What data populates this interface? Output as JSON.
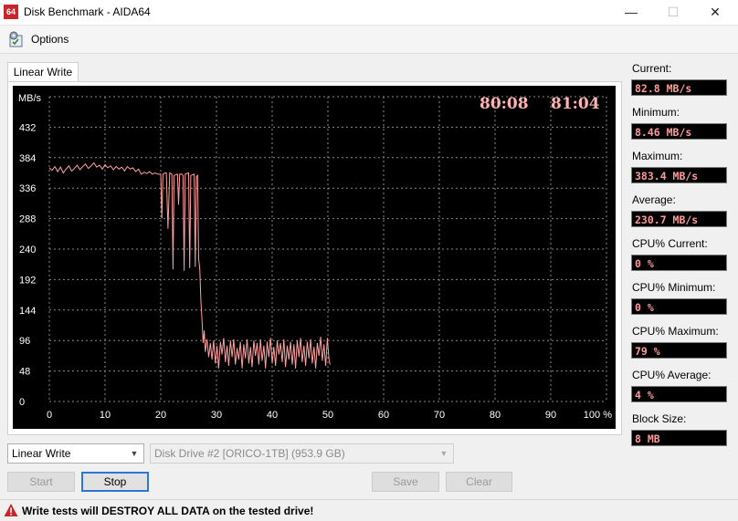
{
  "window": {
    "app_icon_text": "64",
    "title": "Disk Benchmark - AIDA64",
    "minimize": "—",
    "maximize": "☐",
    "close": "✕"
  },
  "menu": {
    "options_label": "Options",
    "options_icon": "options-icon"
  },
  "tab": {
    "label": "Linear Write"
  },
  "chart_data": {
    "type": "line",
    "ylabel": "MB/s",
    "y_ticks": [
      "432",
      "384",
      "336",
      "288",
      "240",
      "192",
      "144",
      "96",
      "48",
      "0"
    ],
    "x_ticks": [
      "0",
      "10",
      "20",
      "30",
      "40",
      "50",
      "60",
      "70",
      "80",
      "90",
      "100 %"
    ],
    "ylim": [
      0,
      480
    ],
    "xlim": [
      0,
      100
    ],
    "grid": true,
    "timers": [
      "80:08",
      "81:04"
    ],
    "colors": {
      "background": "#000000",
      "grid": "#8a8a8a",
      "line": "#ff9f9f",
      "axis_text": "#ffffff",
      "timer_text": "#ffb3b3"
    },
    "series": [
      {
        "values": [
          [
            0,
            368
          ],
          [
            0.5,
            364
          ],
          [
            1,
            370
          ],
          [
            1.5,
            362
          ],
          [
            2,
            369
          ],
          [
            2.5,
            360
          ],
          [
            3,
            366
          ],
          [
            3.5,
            371
          ],
          [
            4,
            363
          ],
          [
            4.5,
            367
          ],
          [
            5,
            372
          ],
          [
            5.5,
            365
          ],
          [
            6,
            370
          ],
          [
            6.5,
            374
          ],
          [
            7,
            367
          ],
          [
            7.5,
            371
          ],
          [
            8,
            376
          ],
          [
            8.5,
            369
          ],
          [
            9,
            372
          ],
          [
            9.5,
            366
          ],
          [
            10,
            373
          ],
          [
            10.5,
            368
          ],
          [
            11,
            371
          ],
          [
            11.5,
            365
          ],
          [
            12,
            370
          ],
          [
            12.5,
            366
          ],
          [
            13,
            369
          ],
          [
            13.5,
            363
          ],
          [
            14,
            370
          ],
          [
            14.5,
            366
          ],
          [
            15,
            368
          ],
          [
            15.5,
            362
          ],
          [
            16,
            366
          ],
          [
            16.5,
            358
          ],
          [
            17,
            361
          ],
          [
            17.5,
            359
          ],
          [
            18,
            362
          ],
          [
            18.5,
            358
          ],
          [
            19,
            360
          ],
          [
            19.5,
            358
          ],
          [
            20,
            358
          ],
          [
            20.2,
            288
          ],
          [
            20.4,
            358
          ],
          [
            20.8,
            360
          ],
          [
            21,
            360
          ],
          [
            21.3,
            272
          ],
          [
            21.6,
            360
          ],
          [
            22,
            358
          ],
          [
            22.2,
            208
          ],
          [
            22.4,
            356
          ],
          [
            23,
            358
          ],
          [
            23.2,
            310
          ],
          [
            23.4,
            358
          ],
          [
            23.8,
            358
          ],
          [
            24,
            356
          ],
          [
            24.2,
            206
          ],
          [
            24.4,
            358
          ],
          [
            25,
            360
          ],
          [
            25.2,
            210
          ],
          [
            25.4,
            356
          ],
          [
            26,
            358
          ],
          [
            26.2,
            212
          ],
          [
            26.4,
            354
          ],
          [
            26.6,
            356
          ],
          [
            26.8,
            224
          ],
          [
            27,
            210
          ],
          [
            27.2,
            160
          ],
          [
            27.4,
            130
          ],
          [
            27.6,
            92
          ],
          [
            27.8,
            112
          ],
          [
            28,
            78
          ],
          [
            28.3,
            98
          ],
          [
            28.6,
            70
          ],
          [
            28.9,
            92
          ],
          [
            29.2,
            66
          ],
          [
            29.5,
            96
          ],
          [
            29.8,
            60
          ],
          [
            30.1,
            88
          ],
          [
            30.4,
            52
          ],
          [
            30.7,
            94
          ],
          [
            31,
            74
          ],
          [
            31.3,
            100
          ],
          [
            31.6,
            62
          ],
          [
            31.9,
            88
          ],
          [
            32.2,
            56
          ],
          [
            32.5,
            96
          ],
          [
            32.8,
            70
          ],
          [
            33.1,
            98
          ],
          [
            33.4,
            58
          ],
          [
            33.7,
            84
          ],
          [
            34,
            66
          ],
          [
            34.3,
            94
          ],
          [
            34.6,
            52
          ],
          [
            34.9,
            90
          ],
          [
            35.2,
            68
          ],
          [
            35.5,
            98
          ],
          [
            35.8,
            60
          ],
          [
            36.1,
            86
          ],
          [
            36.4,
            54
          ],
          [
            36.7,
            96
          ],
          [
            37,
            72
          ],
          [
            37.3,
            92
          ],
          [
            37.6,
            58
          ],
          [
            37.9,
            98
          ],
          [
            38.2,
            64
          ],
          [
            38.5,
            88
          ],
          [
            38.8,
            52
          ],
          [
            39.1,
            94
          ],
          [
            39.4,
            70
          ],
          [
            39.7,
            100
          ],
          [
            40,
            60
          ],
          [
            40.3,
            86
          ],
          [
            40.6,
            56
          ],
          [
            40.9,
            96
          ],
          [
            41.2,
            74
          ],
          [
            41.5,
            92
          ],
          [
            41.8,
            62
          ],
          [
            42.1,
            98
          ],
          [
            42.4,
            54
          ],
          [
            42.7,
            88
          ],
          [
            43,
            66
          ],
          [
            43.3,
            94
          ],
          [
            43.6,
            58
          ],
          [
            43.9,
            90
          ],
          [
            44.2,
            52
          ],
          [
            44.5,
            96
          ],
          [
            44.8,
            70
          ],
          [
            45.1,
            100
          ],
          [
            45.4,
            62
          ],
          [
            45.7,
            88
          ],
          [
            46,
            56
          ],
          [
            46.3,
            94
          ],
          [
            46.6,
            68
          ],
          [
            46.9,
            98
          ],
          [
            47.2,
            60
          ],
          [
            47.5,
            86
          ],
          [
            47.8,
            52
          ],
          [
            48.1,
            92
          ],
          [
            48.4,
            72
          ],
          [
            48.7,
            102
          ],
          [
            49,
            64
          ],
          [
            49.3,
            90
          ],
          [
            49.6,
            56
          ],
          [
            49.9,
            100
          ],
          [
            50.2,
            66
          ],
          [
            50.4,
            58
          ]
        ]
      }
    ]
  },
  "stats": [
    {
      "label": "Current:",
      "value": "82.8 MB/s"
    },
    {
      "label": "Minimum:",
      "value": "8.46 MB/s"
    },
    {
      "label": "Maximum:",
      "value": "383.4 MB/s"
    },
    {
      "label": "Average:",
      "value": "230.7 MB/s"
    },
    {
      "label": "CPU% Current:",
      "value": "0 %"
    },
    {
      "label": "CPU% Minimum:",
      "value": "0 %"
    },
    {
      "label": "CPU% Maximum:",
      "value": "79 %"
    },
    {
      "label": "CPU% Average:",
      "value": "4 %"
    },
    {
      "label": "Block Size:",
      "value": "8 MB"
    }
  ],
  "controls": {
    "test_select": "Linear Write",
    "drive_select": "Disk Drive #2  [ORICO-1TB]  (953.9 GB)",
    "start": "Start",
    "stop": "Stop",
    "save": "Save",
    "clear": "Clear"
  },
  "status": {
    "warning": "Write tests will DESTROY ALL DATA on the tested drive!",
    "warning_icon": "warning-icon"
  }
}
